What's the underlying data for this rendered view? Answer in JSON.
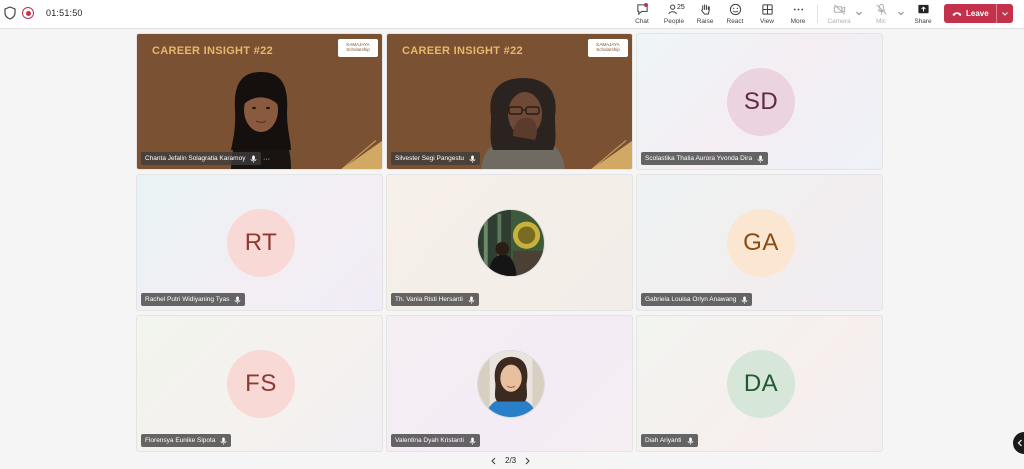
{
  "topbar": {
    "timer": "01:51:50",
    "chat_label": "Chat",
    "people_label": "People",
    "people_count": "25",
    "raise_label": "Raise",
    "react_label": "React",
    "view_label": "View",
    "more_label": "More",
    "camera_label": "Camera",
    "mic_label": "Mic",
    "share_label": "Share",
    "leave_label": "Leave"
  },
  "tiles": [
    {
      "name": "Chanta Jefalin Solagratia Karamoy",
      "banner_title": "CAREER INSIGHT #22",
      "logo_line1": "KAMAJAYA",
      "logo_line2": "Scholarship"
    },
    {
      "name": "Silvester Segi Pangestu",
      "banner_title": "CAREER INSIGHT #22",
      "logo_line1": "KAMAJAYA",
      "logo_line2": "Scholarship"
    },
    {
      "name": "Scolastika Thalia Aurora Yvonda Dira",
      "initials": "SD"
    },
    {
      "name": "Rachel Putri Widiyaning Tyas",
      "initials": "RT"
    },
    {
      "name": "Th. Vania Risti Hersanti"
    },
    {
      "name": "Gabriela Louisa Orlyn Anawang",
      "initials": "GA"
    },
    {
      "name": "Florensya Eunike Sipota",
      "initials": "FS"
    },
    {
      "name": "Valentina Dyah Kristanti"
    },
    {
      "name": "Diah Ariyanti",
      "initials": "DA"
    }
  ],
  "pager": {
    "label": "2/3"
  },
  "colors": {
    "leave": "#c4314b",
    "banner_bg": "#7b5133",
    "banner_gold": "#e8b868",
    "avatar_sd_bg": "#ecd3e0",
    "avatar_sd_fg": "#5d2a47",
    "avatar_rt_bg": "#f8d9d6",
    "avatar_rt_fg": "#8e3a31",
    "avatar_ga_bg": "#fbe6d2",
    "avatar_ga_fg": "#8a4b12",
    "avatar_fs_bg": "#f8d9d6",
    "avatar_fs_fg": "#8e3a31",
    "avatar_da_bg": "#d6e6d9",
    "avatar_da_fg": "#1f5a2e"
  }
}
